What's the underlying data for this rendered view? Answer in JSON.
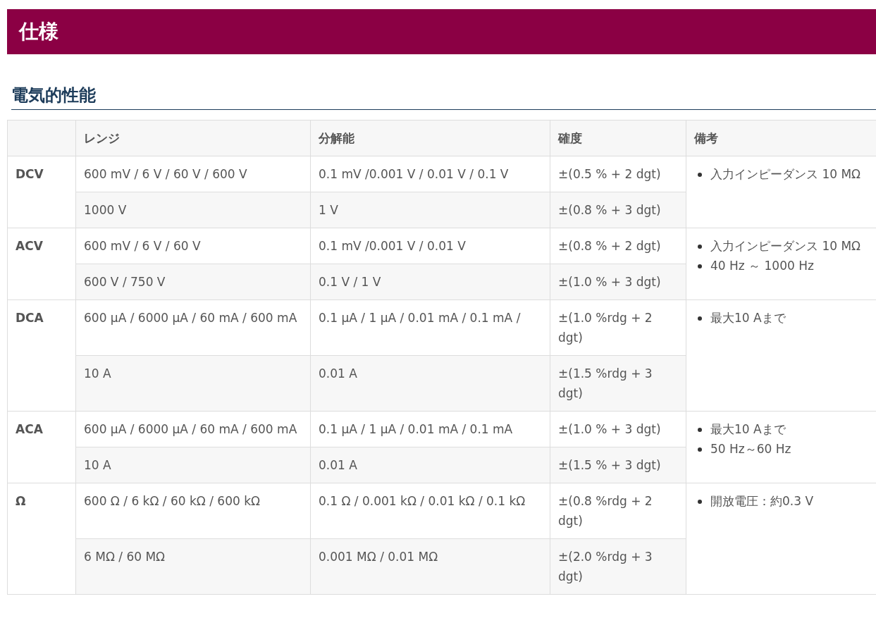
{
  "page_title": "仕様",
  "section_title": "電気的性能",
  "table": {
    "columns": [
      "レンジ",
      "分解能",
      "確度",
      "備考"
    ],
    "groups": [
      {
        "label": "DCV",
        "rows": [
          {
            "range": "600 mV / 6 V / 60 V / 600 V",
            "resolution": "0.1 mV /0.001 V / 0.01 V / 0.1 V",
            "accuracy": "±(0.5 % + 2 dgt)"
          },
          {
            "range": "1000 V",
            "resolution": "1 V",
            "accuracy": "±(0.8 % + 3 dgt)"
          }
        ],
        "notes": [
          "入力インピーダンス 10 MΩ"
        ]
      },
      {
        "label": "ACV",
        "rows": [
          {
            "range": "600 mV / 6 V / 60 V",
            "resolution": "0.1 mV /0.001 V / 0.01 V",
            "accuracy": "±(0.8 % + 2 dgt)"
          },
          {
            "range": "600 V / 750 V",
            "resolution": "0.1 V / 1 V",
            "accuracy": "±(1.0 % + 3 dgt)"
          }
        ],
        "notes": [
          "入力インピーダンス 10 MΩ",
          "40 Hz ～ 1000 Hz"
        ]
      },
      {
        "label": "DCA",
        "rows": [
          {
            "range": "600 μA / 6000 μA / 60 mA / 600 mA",
            "resolution": "0.1 μA / 1 μA / 0.01 mA / 0.1 mA /",
            "accuracy": "±(1.0 %rdg + 2 dgt)"
          },
          {
            "range": "10 A",
            "resolution": "0.01 A",
            "accuracy": "±(1.5 %rdg + 3 dgt)"
          }
        ],
        "notes": [
          "最大10 Aまで"
        ]
      },
      {
        "label": "ACA",
        "rows": [
          {
            "range": "600 μA / 6000 μA / 60 mA / 600 mA",
            "resolution": "0.1 μA / 1 μA / 0.01 mA / 0.1 mA",
            "accuracy": "±(1.0 % + 3 dgt)"
          },
          {
            "range": "10 A",
            "resolution": "0.01 A",
            "accuracy": "±(1.5 % + 3 dgt)"
          }
        ],
        "notes": [
          "最大10 Aまで",
          "50 Hz～60 Hz"
        ]
      },
      {
        "label": "Ω",
        "rows": [
          {
            "range": "600 Ω / 6 kΩ / 60 kΩ / 600 kΩ",
            "resolution": "0.1 Ω / 0.001 kΩ / 0.01 kΩ / 0.1 kΩ",
            "accuracy": "±(0.8 %rdg + 2 dgt)"
          },
          {
            "range": "6 MΩ / 60 MΩ",
            "resolution": "0.001 MΩ / 0.01 MΩ",
            "accuracy": "±(2.0 %rdg + 3 dgt)"
          }
        ],
        "notes": [
          "開放電圧：約0.3 V"
        ]
      }
    ]
  }
}
